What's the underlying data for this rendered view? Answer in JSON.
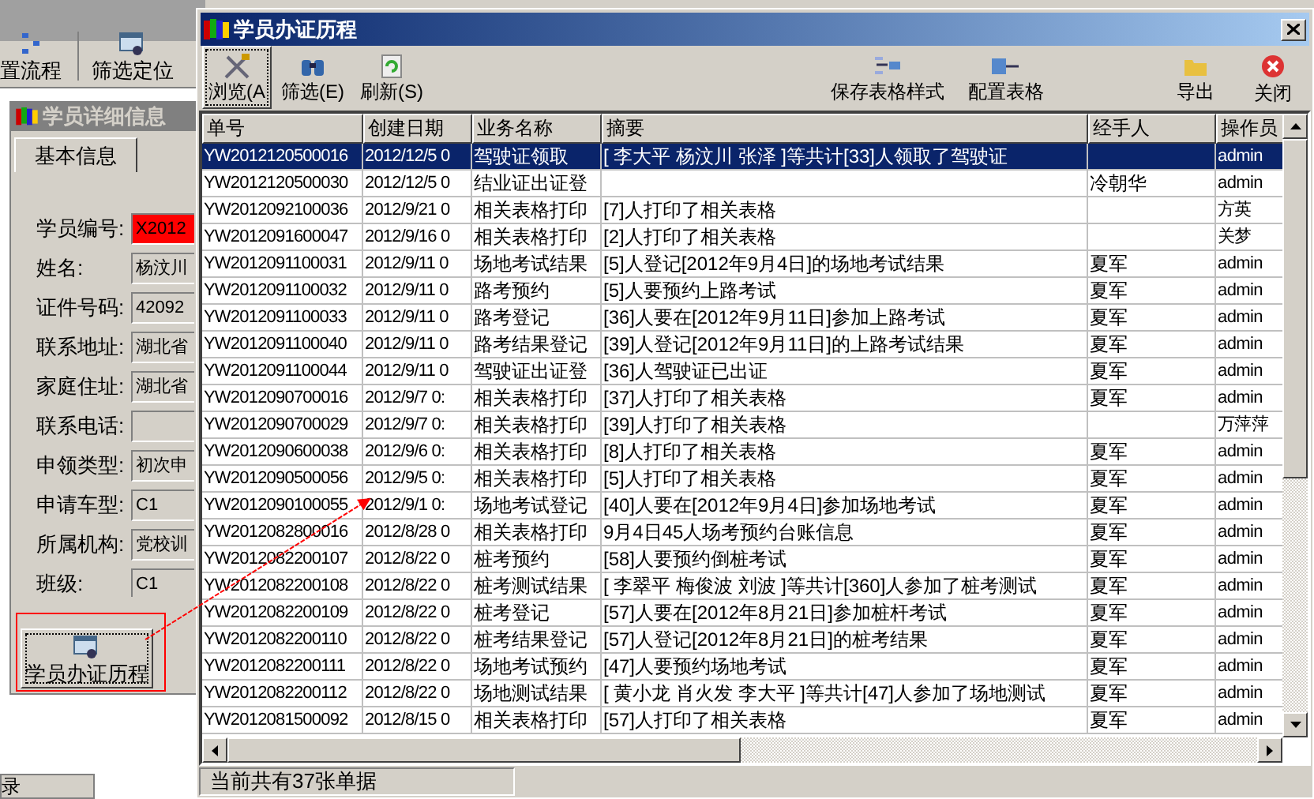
{
  "app_toolbar": [
    {
      "label": "置流程"
    },
    {
      "label": "筛选定位"
    }
  ],
  "detail_window": {
    "title": "学员详细信息",
    "tabs": [
      {
        "label": "基本信息",
        "selected": true
      }
    ],
    "fields": [
      {
        "label": "学员编号:",
        "value": "X2012",
        "highlight": true
      },
      {
        "label": "姓名:",
        "value": "杨汶川",
        "highlight": false
      },
      {
        "label": "证件号码:",
        "value": "42092",
        "highlight": false
      },
      {
        "label": "联系地址:",
        "value": "湖北省",
        "highlight": false
      },
      {
        "label": "家庭住址:",
        "value": "湖北省",
        "highlight": false
      },
      {
        "label": "联系电话:",
        "highlight": false
      },
      {
        "label": "申领类型:",
        "value": "初次申",
        "highlight": false
      },
      {
        "label": "申请车型:",
        "value": "C1",
        "highlight": false
      },
      {
        "label": "所属机构:",
        "value": "党校训",
        "highlight": false
      },
      {
        "label": "班级:",
        "value": "C1",
        "highlight": false
      }
    ],
    "history_button": "学员办证历程"
  },
  "status_fragment": "录",
  "dialog": {
    "title": "学员办证历程",
    "toolbar_left": [
      {
        "label": "浏览(A",
        "pressed": true
      },
      {
        "label": "筛选(E)",
        "pressed": false
      },
      {
        "label": "刷新(S)",
        "pressed": false
      }
    ],
    "toolbar_right": [
      {
        "label": "保存表格样式"
      },
      {
        "label": "配置表格"
      },
      {
        "label": "导出"
      },
      {
        "label": "关闭"
      }
    ],
    "table": {
      "columns": [
        "单号",
        "创建日期",
        "业务名称",
        "摘要",
        "经手人",
        "操作员"
      ],
      "rows": [
        {
          "cells": [
            "YW2012120500016",
            "2012/12/5 0",
            "驾驶证领取",
            "[ 李大平 杨汶川 张泽 ]等共计[33]人领取了驾驶证",
            "",
            "admin"
          ],
          "selected": true
        },
        {
          "cells": [
            "YW2012120500030",
            "2012/12/5 0",
            "结业证出证登",
            "",
            "冷朝华",
            "admin"
          ],
          "selected": false
        },
        {
          "cells": [
            "YW2012092100036",
            "2012/9/21 0",
            "相关表格打印",
            "[7]人打印了相关表格",
            "",
            "方英"
          ],
          "selected": false
        },
        {
          "cells": [
            "YW2012091600047",
            "2012/9/16 0",
            "相关表格打印",
            "[2]人打印了相关表格",
            "",
            "关梦"
          ],
          "selected": false
        },
        {
          "cells": [
            "YW2012091100031",
            "2012/9/11 0",
            "场地考试结果",
            "[5]人登记[2012年9月4日]的场地考试结果",
            "夏军",
            "admin"
          ],
          "selected": false
        },
        {
          "cells": [
            "YW2012091100032",
            "2012/9/11 0",
            "路考预约",
            "[5]人要预约上路考试",
            "夏军",
            "admin"
          ],
          "selected": false
        },
        {
          "cells": [
            "YW2012091100033",
            "2012/9/11 0",
            "路考登记",
            "[36]人要在[2012年9月11日]参加上路考试",
            "夏军",
            "admin"
          ],
          "selected": false
        },
        {
          "cells": [
            "YW2012091100040",
            "2012/9/11 0",
            "路考结果登记",
            "[39]人登记[2012年9月11日]的上路考试结果",
            "夏军",
            "admin"
          ],
          "selected": false
        },
        {
          "cells": [
            "YW2012091100044",
            "2012/9/11 0",
            "驾驶证出证登",
            "[36]人驾驶证已出证",
            "夏军",
            "admin"
          ],
          "selected": false
        },
        {
          "cells": [
            "YW2012090700016",
            "2012/9/7 0:",
            "相关表格打印",
            "[37]人打印了相关表格",
            "夏军",
            "admin"
          ],
          "selected": false
        },
        {
          "cells": [
            "YW2012090700029",
            "2012/9/7 0:",
            "相关表格打印",
            "[39]人打印了相关表格",
            "",
            "万萍萍"
          ],
          "selected": false
        },
        {
          "cells": [
            "YW2012090600038",
            "2012/9/6 0:",
            "相关表格打印",
            "[8]人打印了相关表格",
            "夏军",
            "admin"
          ],
          "selected": false
        },
        {
          "cells": [
            "YW2012090500056",
            "2012/9/5 0:",
            "相关表格打印",
            "[5]人打印了相关表格",
            "夏军",
            "admin"
          ],
          "selected": false
        },
        {
          "cells": [
            "YW2012090100055",
            "2012/9/1 0:",
            "场地考试登记",
            "[40]人要在[2012年9月4日]参加场地考试",
            "夏军",
            "admin"
          ],
          "selected": false
        },
        {
          "cells": [
            "YW2012082800016",
            "2012/8/28 0",
            "相关表格打印",
            "9月4日45人场考预约台账信息",
            "夏军",
            "admin"
          ],
          "selected": false
        },
        {
          "cells": [
            "YW2012082200107",
            "2012/8/22 0",
            "桩考预约",
            "[58]人要预约倒桩考试",
            "夏军",
            "admin"
          ],
          "selected": false
        },
        {
          "cells": [
            "YW2012082200108",
            "2012/8/22 0",
            "桩考测试结果",
            "[ 李翠平 梅俊波 刘波 ]等共计[360]人参加了桩考测试",
            "夏军",
            "admin"
          ],
          "selected": false
        },
        {
          "cells": [
            "YW2012082200109",
            "2012/8/22 0",
            "桩考登记",
            "[57]人要在[2012年8月21日]参加桩杆考试",
            "夏军",
            "admin"
          ],
          "selected": false
        },
        {
          "cells": [
            "YW2012082200110",
            "2012/8/22 0",
            "桩考结果登记",
            "[57]人登记[2012年8月21日]的桩考结果",
            "夏军",
            "admin"
          ],
          "selected": false
        },
        {
          "cells": [
            "YW2012082200111",
            "2012/8/22 0",
            "场地考试预约",
            "[47]人要预约场地考试",
            "夏军",
            "admin"
          ],
          "selected": false
        },
        {
          "cells": [
            "YW2012082200112",
            "2012/8/22 0",
            "场地测试结果",
            "[ 黄小龙 肖火发 李大平 ]等共计[47]人参加了场地测试",
            "夏军",
            "admin"
          ],
          "selected": false
        },
        {
          "cells": [
            "YW2012081500092",
            "2012/8/15 0",
            "相关表格打印",
            "[57]人打印了相关表格",
            "夏军",
            "admin"
          ],
          "selected": false
        }
      ]
    },
    "status": "当前共有37张单据"
  }
}
